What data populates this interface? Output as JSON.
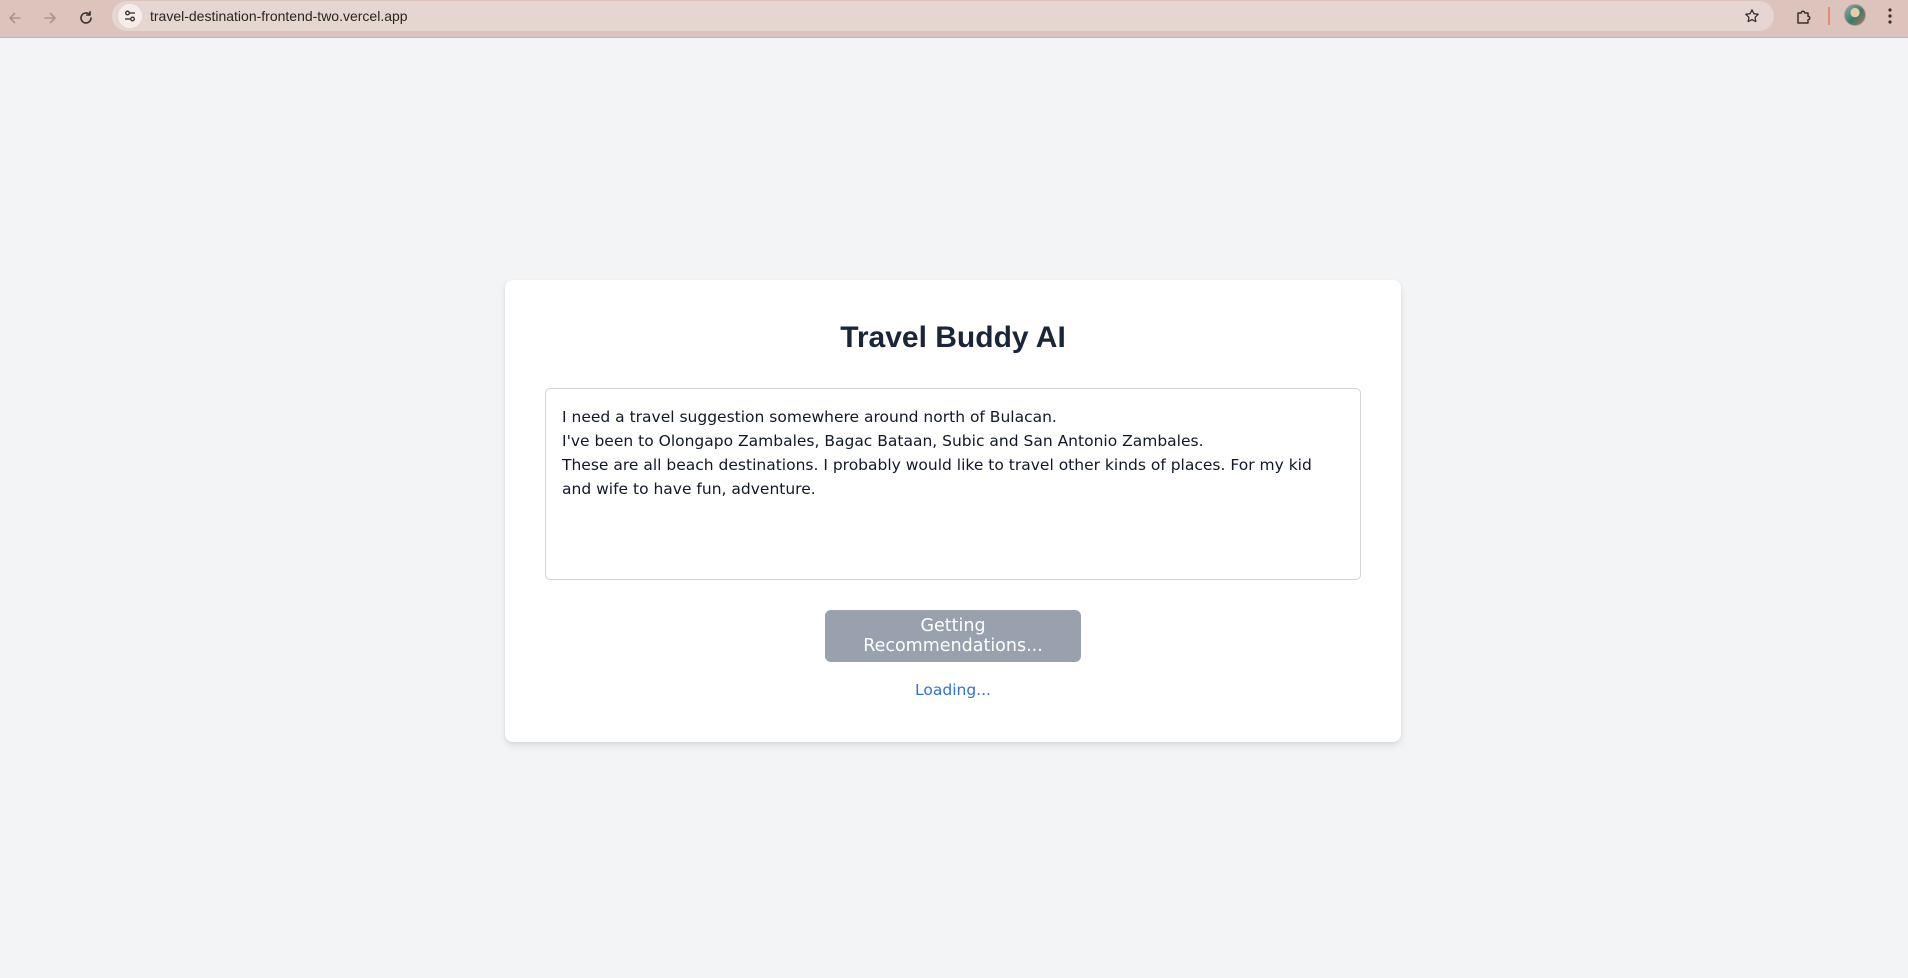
{
  "browser": {
    "url": "travel-destination-frontend-two.vercel.app",
    "icons": {
      "back": "arrow-left-icon",
      "forward": "arrow-right-icon",
      "reload": "reload-icon",
      "site_info": "tune-icon",
      "bookmark": "star-icon",
      "extensions": "puzzle-icon",
      "profile": "avatar",
      "menu": "kebab-menu-icon"
    }
  },
  "app": {
    "title": "Travel Buddy AI",
    "prompt_value": "I need a travel suggestion somewhere around north of Bulacan.\nI've been to Olongapo Zambales, Bagac Bataan, Subic and San Antonio Zambales.\nThese are all beach destinations. I probably would like to travel other kinds of places. For my kid and wife to have fun, adventure.",
    "submit_label": "Getting Recommendations...",
    "status_text": "Loading..."
  },
  "colors": {
    "page_background": "#f3f4f6",
    "title": "#1a2537",
    "button_disabled": "#99a1af",
    "loading_text": "#2f6fde",
    "browser_bar": "#dcc4bd"
  }
}
